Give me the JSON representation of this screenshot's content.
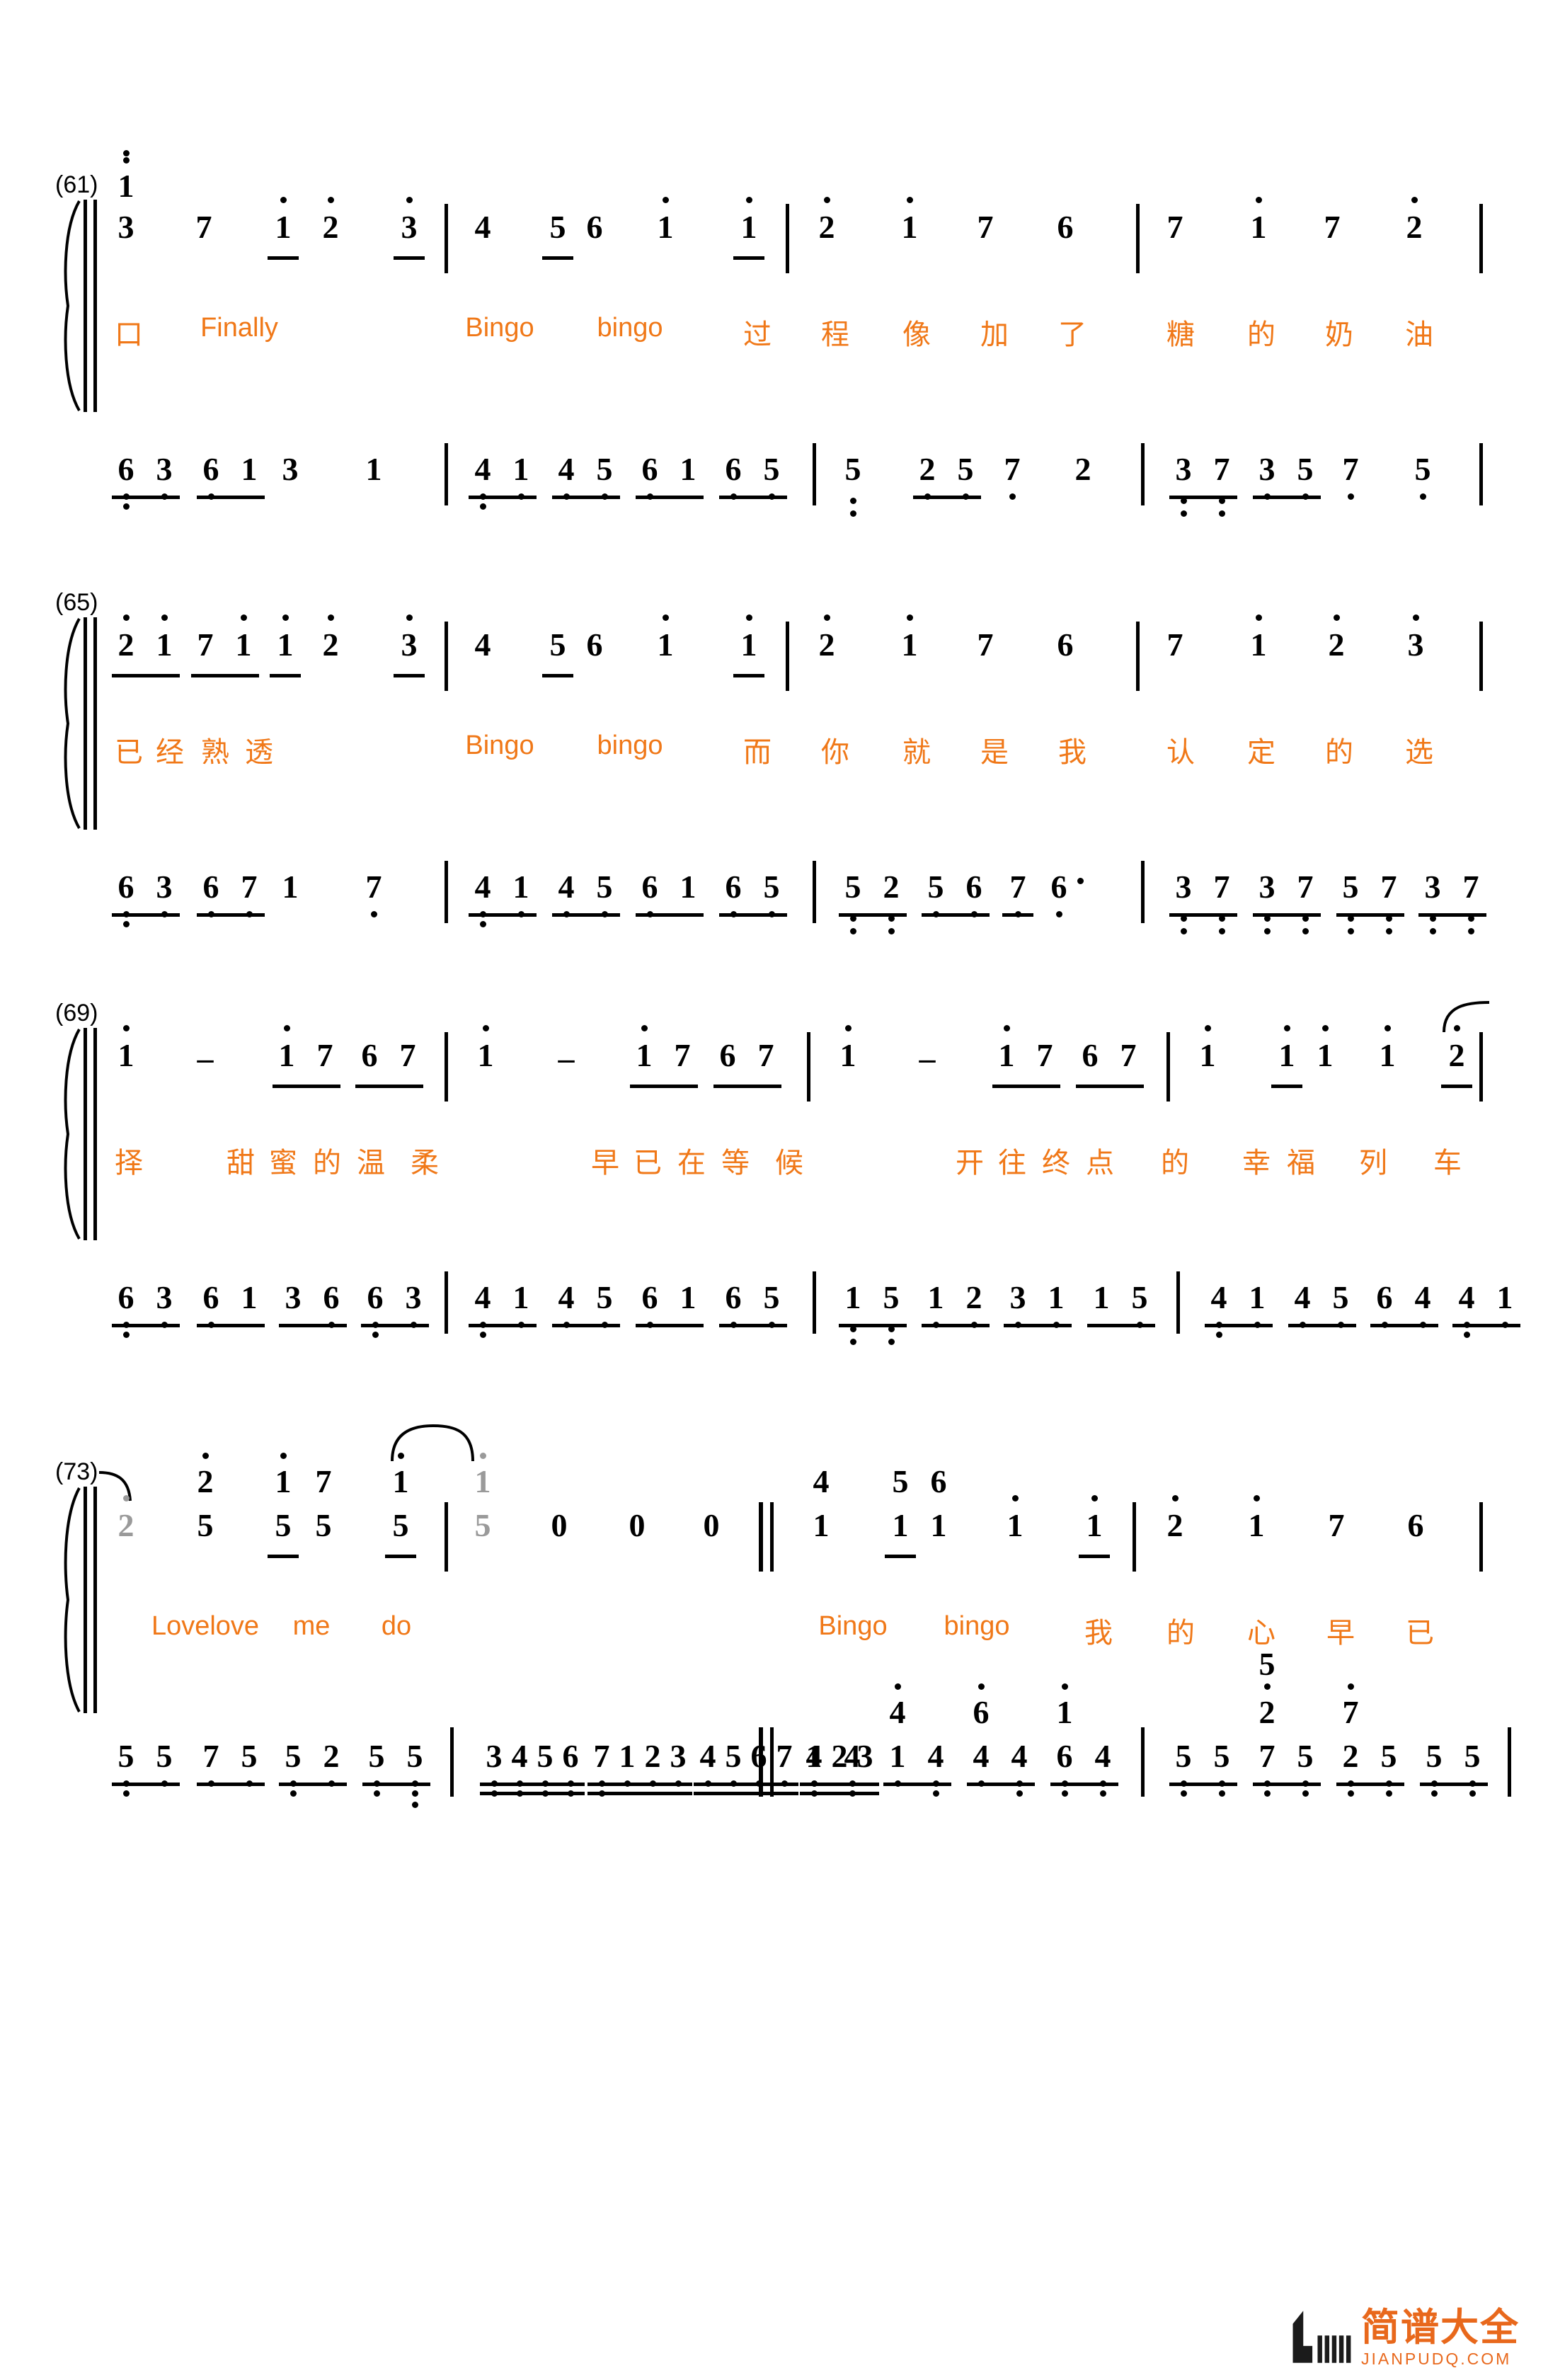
{
  "document": {
    "type": "numbered-musical-notation",
    "notation": "jianpu",
    "accent_color": "#F07818",
    "tie_note_color": "#9a9a9a"
  },
  "systems": [
    {
      "bar_number": "(61)",
      "melody": [
        {
          "n": "3",
          "up": [
            {
              "num": "1",
              "dot": "top1"
            }
          ],
          "dot": 0,
          "beam": null
        },
        {
          "n": "7",
          "dot": 0
        },
        {
          "n": "1",
          "dot": 1,
          "beam": "under"
        },
        {
          "n": "2",
          "dot": 1
        },
        {
          "n": "3",
          "dot": 1,
          "beam": "under"
        },
        {
          "bar": true
        },
        {
          "n": "4",
          "dot": 0
        },
        {
          "n": "5",
          "dot": 0,
          "beam": "under"
        },
        {
          "n": "6",
          "dot": 0
        },
        {
          "n": "1",
          "dot": 1
        },
        {
          "n": "1",
          "dot": 1,
          "beam": "under"
        },
        {
          "bar": true
        },
        {
          "n": "2",
          "dot": 1
        },
        {
          "n": "1",
          "dot": 1
        },
        {
          "n": "7",
          "dot": 0
        },
        {
          "n": "6",
          "dot": 0
        },
        {
          "bar": true
        },
        {
          "n": "7",
          "dot": 0
        },
        {
          "n": "1",
          "dot": 1
        },
        {
          "n": "7",
          "dot": 0
        },
        {
          "n": "2",
          "dot": 1
        },
        {
          "bar": true
        }
      ],
      "lyrics": [
        "口",
        "Finally",
        "Bingo",
        "bingo",
        "过",
        "程",
        "像",
        "加",
        "了",
        "糖",
        "的",
        "奶",
        "油"
      ],
      "bass": [
        {
          "n": "6",
          "dot": -2,
          "beam": "under"
        },
        {
          "n": "3",
          "dot": -1
        },
        {
          "n": "6",
          "dot": -1,
          "beam": "under"
        },
        {
          "n": "1",
          "dot": 0
        },
        {
          "n": "3",
          "dot": 0
        },
        {
          "n": "1",
          "dot": 0
        },
        {
          "bar": true
        },
        {
          "n": "4",
          "dot": -2,
          "beam": "under"
        },
        {
          "n": "1",
          "dot": -1
        },
        {
          "n": "4",
          "dot": -1,
          "beam": "under"
        },
        {
          "n": "5",
          "dot": -1
        },
        {
          "n": "6",
          "dot": -1,
          "beam": "under"
        },
        {
          "n": "1",
          "dot": 0
        },
        {
          "n": "6",
          "dot": -1,
          "beam": "under"
        },
        {
          "n": "5",
          "dot": -1
        },
        {
          "bar": true
        },
        {
          "n": "5",
          "dot": -2
        },
        {
          "n": "2",
          "dot": -1,
          "beam": "under"
        },
        {
          "n": "5",
          "dot": -1
        },
        {
          "n": "7",
          "dot": -1
        },
        {
          "n": "2",
          "dot": 0
        },
        {
          "bar": true
        },
        {
          "n": "3",
          "dot": -2,
          "beam": "under"
        },
        {
          "n": "7",
          "dot": -2
        },
        {
          "n": "3",
          "dot": -1,
          "beam": "under"
        },
        {
          "n": "5",
          "dot": -1
        },
        {
          "n": "7",
          "dot": -1
        },
        {
          "n": "5",
          "dot": -1
        },
        {
          "bar": true
        }
      ]
    },
    {
      "bar_number": "(65)",
      "melody": [
        {
          "n": "2",
          "dot": 1,
          "beam": "under"
        },
        {
          "n": "1",
          "dot": 1
        },
        {
          "n": "7",
          "dot": 0,
          "beam": "under"
        },
        {
          "n": "1",
          "dot": 1
        },
        {
          "n": "1",
          "dot": 1,
          "beam": "under"
        },
        {
          "n": "2",
          "dot": 1
        },
        {
          "n": "3",
          "dot": 1,
          "beam": "under"
        },
        {
          "bar": true
        },
        {
          "n": "4",
          "dot": 0
        },
        {
          "n": "5",
          "dot": 0,
          "beam": "under"
        },
        {
          "n": "6",
          "dot": 0
        },
        {
          "n": "1",
          "dot": 1
        },
        {
          "n": "1",
          "dot": 1,
          "beam": "under"
        },
        {
          "bar": true
        },
        {
          "n": "2",
          "dot": 1
        },
        {
          "n": "1",
          "dot": 1
        },
        {
          "n": "7",
          "dot": 0
        },
        {
          "n": "6",
          "dot": 0
        },
        {
          "bar": true
        },
        {
          "n": "7",
          "dot": 0
        },
        {
          "n": "1",
          "dot": 1
        },
        {
          "n": "2",
          "dot": 1
        },
        {
          "n": "3",
          "dot": 1
        },
        {
          "bar": true
        }
      ],
      "lyrics": [
        "已",
        "经",
        "熟",
        "透",
        "Bingo",
        "bingo",
        "而",
        "你",
        "就",
        "是",
        "我",
        "认",
        "定",
        "的",
        "选"
      ],
      "bass": [
        {
          "n": "6",
          "dot": -2,
          "beam": "under"
        },
        {
          "n": "3",
          "dot": -1
        },
        {
          "n": "6",
          "dot": -1,
          "beam": "under"
        },
        {
          "n": "7",
          "dot": -1
        },
        {
          "n": "1",
          "dot": 0
        },
        {
          "n": "7",
          "dot": -1
        },
        {
          "bar": true
        },
        {
          "n": "4",
          "dot": -2,
          "beam": "under"
        },
        {
          "n": "1",
          "dot": -1
        },
        {
          "n": "4",
          "dot": -1,
          "beam": "under"
        },
        {
          "n": "5",
          "dot": -1
        },
        {
          "n": "6",
          "dot": -1,
          "beam": "under"
        },
        {
          "n": "1",
          "dot": 0
        },
        {
          "n": "6",
          "dot": -1,
          "beam": "under"
        },
        {
          "n": "5",
          "dot": -1
        },
        {
          "bar": true
        },
        {
          "n": "5",
          "dot": -2,
          "beam": "under"
        },
        {
          "n": "2",
          "dot": -2
        },
        {
          "n": "5",
          "dot": -1,
          "beam": "under"
        },
        {
          "n": "6",
          "dot": -1
        },
        {
          "n": "7",
          "dot": -1,
          "beam": "under"
        },
        {
          "n": "6",
          "dot": -1,
          "aug": true
        },
        {
          "bar": true
        },
        {
          "n": "3",
          "dot": -2,
          "beam": "under"
        },
        {
          "n": "7",
          "dot": -2
        },
        {
          "n": "3",
          "dot": -2,
          "beam": "under"
        },
        {
          "n": "7",
          "dot": -2
        },
        {
          "n": "5",
          "dot": -2,
          "beam": "under"
        },
        {
          "n": "7",
          "dot": -2
        },
        {
          "n": "3",
          "dot": -2,
          "beam": "under"
        },
        {
          "n": "7",
          "dot": -2
        },
        {
          "bar": true
        }
      ]
    },
    {
      "bar_number": "(69)",
      "melody": [
        {
          "n": "1",
          "dot": 1
        },
        {
          "dash": "-"
        },
        {
          "n": "1",
          "dot": 1,
          "beam": "under"
        },
        {
          "n": "7",
          "dot": 0
        },
        {
          "n": "6",
          "dot": 0,
          "beam": "under"
        },
        {
          "n": "7",
          "dot": 0
        },
        {
          "bar": true
        },
        {
          "n": "1",
          "dot": 1
        },
        {
          "dash": "-"
        },
        {
          "n": "1",
          "dot": 1,
          "beam": "under"
        },
        {
          "n": "7",
          "dot": 0
        },
        {
          "n": "6",
          "dot": 0,
          "beam": "under"
        },
        {
          "n": "7",
          "dot": 0
        },
        {
          "bar": true
        },
        {
          "n": "1",
          "dot": 1
        },
        {
          "dash": "-"
        },
        {
          "n": "1",
          "dot": 1,
          "beam": "under"
        },
        {
          "n": "7",
          "dot": 0
        },
        {
          "n": "6",
          "dot": 0,
          "beam": "under"
        },
        {
          "n": "7",
          "dot": 0
        },
        {
          "bar": true
        },
        {
          "n": "1",
          "dot": 1
        },
        {
          "n": "1",
          "dot": 1,
          "beam": "under"
        },
        {
          "n": "1",
          "dot": 1
        },
        {
          "n": "1",
          "dot": 1
        },
        {
          "n": "2",
          "dot": 1,
          "beam": "under",
          "tie": true
        },
        {
          "bar": true
        }
      ],
      "lyrics": [
        "择",
        "甜",
        "蜜",
        "的",
        "温",
        "柔",
        "早",
        "已",
        "在",
        "等",
        "候",
        "开",
        "往",
        "终",
        "点",
        "的",
        "幸",
        "福",
        "列",
        "车"
      ],
      "bass": [
        {
          "n": "6",
          "dot": -2,
          "beam": "under"
        },
        {
          "n": "3",
          "dot": -1
        },
        {
          "n": "6",
          "dot": -1,
          "beam": "under"
        },
        {
          "n": "1",
          "dot": 0
        },
        {
          "n": "3",
          "dot": 0,
          "beam": "under"
        },
        {
          "n": "6",
          "dot": -1
        },
        {
          "n": "6",
          "dot": -2,
          "beam": "under"
        },
        {
          "n": "3",
          "dot": -1
        },
        {
          "bar": true
        },
        {
          "n": "4",
          "dot": -2,
          "beam": "under"
        },
        {
          "n": "1",
          "dot": -1
        },
        {
          "n": "4",
          "dot": -1,
          "beam": "under"
        },
        {
          "n": "5",
          "dot": -1
        },
        {
          "n": "6",
          "dot": -1,
          "beam": "under"
        },
        {
          "n": "1",
          "dot": 0
        },
        {
          "n": "6",
          "dot": -1,
          "beam": "under"
        },
        {
          "n": "5",
          "dot": -1
        },
        {
          "bar": true
        },
        {
          "n": "1",
          "dot": -2,
          "beam": "under"
        },
        {
          "n": "5",
          "dot": -2
        },
        {
          "n": "1",
          "dot": -1,
          "beam": "under"
        },
        {
          "n": "2",
          "dot": -1
        },
        {
          "n": "3",
          "dot": -1,
          "beam": "under"
        },
        {
          "n": "1",
          "dot": -1
        },
        {
          "n": "1",
          "dot": 0,
          "beam": "under"
        },
        {
          "n": "5",
          "dot": -1
        },
        {
          "bar": true
        },
        {
          "n": "4",
          "dot": -2,
          "beam": "under"
        },
        {
          "n": "1",
          "dot": -1
        },
        {
          "n": "4",
          "dot": -1,
          "beam": "under"
        },
        {
          "n": "5",
          "dot": -1
        },
        {
          "n": "6",
          "dot": -1,
          "beam": "under"
        },
        {
          "n": "4",
          "dot": -1
        },
        {
          "n": "4",
          "dot": -2,
          "beam": "under"
        },
        {
          "n": "1",
          "dot": -1
        },
        {
          "bar": true
        }
      ]
    },
    {
      "bar_number": "(73)",
      "melody": [
        {
          "n": "2",
          "dot": 1,
          "gray": true
        },
        {
          "n": "5",
          "up": [
            {
              "num": "2",
              "dot": "top1"
            }
          ],
          "dot": 0
        },
        {
          "n": "5",
          "up": [
            {
              "num": "1",
              "dot": "top1"
            }
          ],
          "dot": 0,
          "beam": "under"
        },
        {
          "n": "5",
          "up": [
            {
              "num": "7",
              "dot": "none"
            }
          ],
          "dot": 0
        },
        {
          "n": "5",
          "up": [
            {
              "num": "1",
              "dot": "top1"
            }
          ],
          "dot": 0,
          "beam": "under",
          "tieStart": true
        },
        {
          "bar": true
        },
        {
          "n": "5",
          "up": [
            {
              "num": "1",
              "dot": "top1"
            }
          ],
          "dot": 0,
          "gray": true
        },
        {
          "n": "0",
          "dot": 0
        },
        {
          "n": "0",
          "dot": 0
        },
        {
          "n": "0",
          "dot": 0
        },
        {
          "repeat": true
        },
        {
          "n": "1",
          "up": [
            {
              "num": "4",
              "dot": "none"
            }
          ],
          "dot": 0
        },
        {
          "n": "1",
          "up": [
            {
              "num": "5",
              "dot": "none"
            }
          ],
          "dot": 0,
          "beam": "under"
        },
        {
          "n": "1",
          "up": [
            {
              "num": "6",
              "dot": "none"
            }
          ],
          "dot": 0
        },
        {
          "n": "1",
          "dot": 1
        },
        {
          "n": "1",
          "dot": 1,
          "beam": "under"
        },
        {
          "bar": true
        },
        {
          "n": "2",
          "dot": 1
        },
        {
          "n": "1",
          "dot": 1
        },
        {
          "n": "7",
          "dot": 0
        },
        {
          "n": "6",
          "dot": 0
        },
        {
          "bar": true
        }
      ],
      "lyrics": [
        "Lovelove",
        "me",
        "do",
        "Bingo",
        "bingo",
        "我",
        "的",
        "心",
        "早",
        "已"
      ],
      "bass": [
        {
          "n": "5",
          "dot": -1,
          "beam": "under"
        },
        {
          "n": "5",
          "dot": -1
        },
        {
          "n": "7",
          "dot": -1,
          "beam": "under"
        },
        {
          "n": "5",
          "dot": -1
        },
        {
          "n": "5",
          "dot": -2,
          "beam": "under"
        },
        {
          "n": "2",
          "dot": -1
        },
        {
          "n": "5",
          "dot": -2,
          "beam": "under"
        },
        {
          "n": "5",
          "dot": -3
        },
        {
          "bar": true
        },
        {
          "run": [
            "3",
            "4",
            "5",
            "6",
            "7",
            "1",
            "2",
            "3",
            "4",
            "5",
            "6",
            "7",
            "1",
            "2",
            "3"
          ],
          "run_dots": [
            -2,
            -2,
            -2,
            -2,
            -2,
            -1,
            -1,
            -1,
            -1,
            -1,
            -1,
            -1,
            -1,
            0,
            0
          ]
        },
        {
          "repeat": true
        },
        {
          "n": "4",
          "dot": -2,
          "beam": "under"
        },
        {
          "n": "4",
          "dot": -2
        },
        {
          "n": "1",
          "up": [
            {
              "num": "4",
              "dot": "top1"
            }
          ],
          "dot": -1,
          "beam": "under"
        },
        {
          "n": "4",
          "dot": -2
        },
        {
          "n": "4",
          "up": [
            {
              "num": "6",
              "dot": "top1"
            }
          ],
          "dot": -1,
          "beam": "under"
        },
        {
          "n": "4",
          "dot": -2
        },
        {
          "n": "6",
          "up": [
            {
              "num": "1",
              "dot": "top1"
            }
          ],
          "dot": -2,
          "beam": "under"
        },
        {
          "n": "4",
          "dot": -2
        },
        {
          "bar": true
        },
        {
          "n": "5",
          "dot": -2,
          "beam": "under"
        },
        {
          "n": "5",
          "dot": -2
        },
        {
          "n": "7",
          "up": [
            {
              "num": "2",
              "dot": "top1"
            },
            {
              "num": "5",
              "dot": "none"
            }
          ],
          "dot": -2,
          "beam": "under"
        },
        {
          "n": "5",
          "dot": -2
        },
        {
          "n": "2",
          "up": [
            {
              "num": "7",
              "dot": "top1"
            }
          ],
          "dot": -2,
          "beam": "under"
        },
        {
          "n": "5",
          "dot": -2
        },
        {
          "n": "5",
          "dot": -2,
          "beam": "under"
        },
        {
          "n": "5",
          "dot": -2
        },
        {
          "bar": true
        }
      ]
    }
  ],
  "watermark": {
    "cn": "简谱大全",
    "en": "JIANPUDQ.COM"
  }
}
